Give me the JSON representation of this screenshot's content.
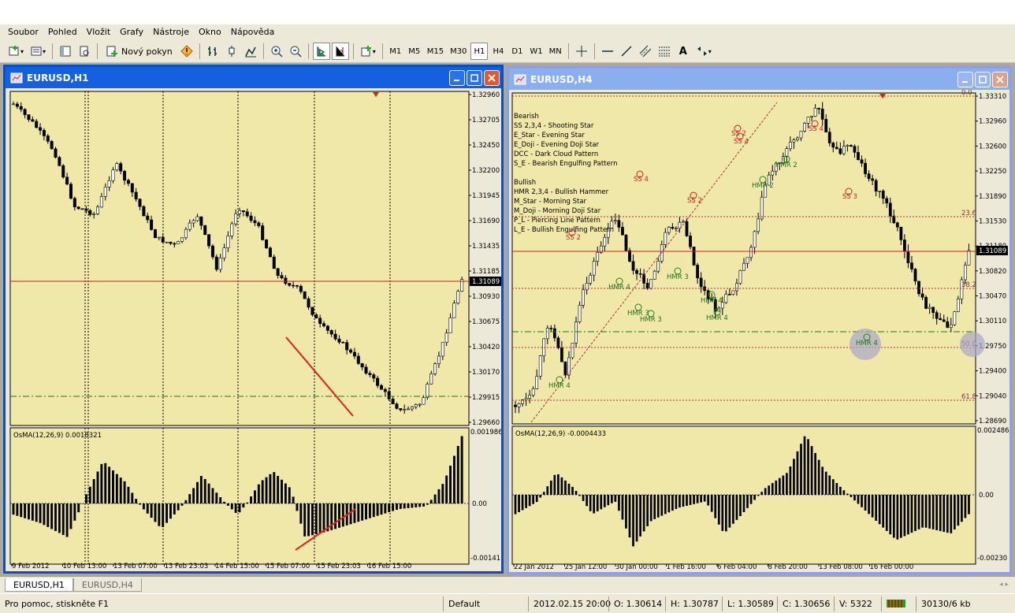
{
  "menu": [
    "Soubor",
    "Pohled",
    "Vložit",
    "Grafy",
    "Nástroje",
    "Okno",
    "Nápověda"
  ],
  "toolbar": {
    "new_order": "Nový pokyn",
    "timeframes": [
      "M1",
      "M5",
      "M15",
      "M30",
      "H1",
      "H4",
      "D1",
      "W1",
      "MN"
    ],
    "active_tf": "H1",
    "text_tool": "A"
  },
  "windows": {
    "left": {
      "title": "EURUSD,H1",
      "osma_label": "OsMA(12,26,9) 0.0018321",
      "current_price": "1.31089",
      "price_ticks": [
        "1.32960",
        "1.32705",
        "1.32450",
        "1.32200",
        "1.31945",
        "1.31690",
        "1.31435",
        "1.31185",
        "1.30930",
        "1.30675",
        "1.30420",
        "1.30170",
        "1.29915",
        "1.29660"
      ],
      "osma_ticks": [
        "0.001986",
        "0.00",
        "-0.00141"
      ],
      "time_labels": [
        "9 Feb 2012",
        "10 Feb 13:00",
        "13 Feb 07:00",
        "13 Feb 23:03",
        "14 Feb 15:00",
        "15 Feb 07:00",
        "15 Feb 23:03",
        "16 Feb 15:00"
      ]
    },
    "right": {
      "title": "EURUSD,H4",
      "osma_label": "OsMA(12,26,9) -0.0004433",
      "current_price": "1.31089",
      "price_ticks": [
        "1.33310",
        "1.32960",
        "1.32600",
        "1.32250",
        "1.31890",
        "1.31530",
        "1.31180",
        "1.30820",
        "1.30470",
        "1.30110",
        "1.29750",
        "1.29400",
        "1.29040",
        "1.28690"
      ],
      "osma_ticks": [
        "0.002486",
        "0.00",
        "-0.00230"
      ],
      "fib_labels": [
        "0.0",
        "23.6",
        "38.2",
        "50.0",
        "61.8"
      ],
      "time_labels": [
        "22 Jan 2012",
        "25 Jan 12:00",
        "30 Jan 00:00",
        "1 Feb 16:00",
        "6 Feb 04:00",
        "8 Feb 20:00",
        "13 Feb 08:00",
        "16 Feb 00:00"
      ],
      "legend": [
        "Bearish",
        "SS 2,3,4 - Shooting Star",
        "E_Star   - Evening Star",
        "E_Doji   - Evening Doji Star",
        "DCC      - Dark Cloud Pattern",
        "S_E      - Bearish Engulfing Pattern",
        "",
        "Bullish",
        "HMR 2,3,4 - Bullish Hammer",
        "M_Star    - Morning Star",
        "M_Doji    - Morning Doji Star",
        "P_L       - Piercing Line Pattern",
        "L_E       - Bullish Engulfing Pattern"
      ],
      "annotations": {
        "hammers": [
          "HMR 4",
          "HMR 4",
          "HMR 3",
          "HMR 3",
          "HMR 2",
          "HMR 4",
          "HMR 4",
          "HMR 2",
          "HMR 4",
          "HMR 3"
        ],
        "stars": [
          "SS 4",
          "SS 2",
          "SS 2",
          "SS 4",
          "SS 3",
          "SS 4",
          "SS 2"
        ]
      }
    }
  },
  "tabs": [
    "EURUSD,H1",
    "EURUSD,H4"
  ],
  "status": {
    "help": "Pro pomoc, stiskněte F1",
    "profile": "Default",
    "datetime": "2012.02.15 20:00",
    "open": "O: 1.30614",
    "high": "H: 1.30787",
    "low": "L: 1.30589",
    "close": "C: 1.30656",
    "volume": "V: 5322",
    "traffic": "30130/6 kb"
  },
  "colors": {
    "chart_bg": "#f0e8a8",
    "grid": "#000000",
    "current_price_line": "#cc2020",
    "fib_line": "#b03040",
    "support_line": "#108010",
    "trend_line": "#e02020",
    "title_active": "#1560e0"
  }
}
